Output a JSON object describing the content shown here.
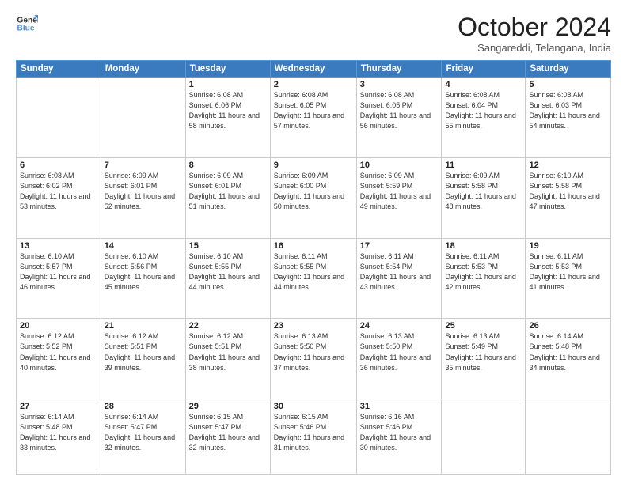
{
  "header": {
    "logo_line1": "General",
    "logo_line2": "Blue",
    "month": "October 2024",
    "location": "Sangareddi, Telangana, India"
  },
  "weekdays": [
    "Sunday",
    "Monday",
    "Tuesday",
    "Wednesday",
    "Thursday",
    "Friday",
    "Saturday"
  ],
  "weeks": [
    [
      {
        "day": "",
        "sunrise": "",
        "sunset": "",
        "daylight": ""
      },
      {
        "day": "",
        "sunrise": "",
        "sunset": "",
        "daylight": ""
      },
      {
        "day": "1",
        "sunrise": "Sunrise: 6:08 AM",
        "sunset": "Sunset: 6:06 PM",
        "daylight": "Daylight: 11 hours and 58 minutes."
      },
      {
        "day": "2",
        "sunrise": "Sunrise: 6:08 AM",
        "sunset": "Sunset: 6:05 PM",
        "daylight": "Daylight: 11 hours and 57 minutes."
      },
      {
        "day": "3",
        "sunrise": "Sunrise: 6:08 AM",
        "sunset": "Sunset: 6:05 PM",
        "daylight": "Daylight: 11 hours and 56 minutes."
      },
      {
        "day": "4",
        "sunrise": "Sunrise: 6:08 AM",
        "sunset": "Sunset: 6:04 PM",
        "daylight": "Daylight: 11 hours and 55 minutes."
      },
      {
        "day": "5",
        "sunrise": "Sunrise: 6:08 AM",
        "sunset": "Sunset: 6:03 PM",
        "daylight": "Daylight: 11 hours and 54 minutes."
      }
    ],
    [
      {
        "day": "6",
        "sunrise": "Sunrise: 6:08 AM",
        "sunset": "Sunset: 6:02 PM",
        "daylight": "Daylight: 11 hours and 53 minutes."
      },
      {
        "day": "7",
        "sunrise": "Sunrise: 6:09 AM",
        "sunset": "Sunset: 6:01 PM",
        "daylight": "Daylight: 11 hours and 52 minutes."
      },
      {
        "day": "8",
        "sunrise": "Sunrise: 6:09 AM",
        "sunset": "Sunset: 6:01 PM",
        "daylight": "Daylight: 11 hours and 51 minutes."
      },
      {
        "day": "9",
        "sunrise": "Sunrise: 6:09 AM",
        "sunset": "Sunset: 6:00 PM",
        "daylight": "Daylight: 11 hours and 50 minutes."
      },
      {
        "day": "10",
        "sunrise": "Sunrise: 6:09 AM",
        "sunset": "Sunset: 5:59 PM",
        "daylight": "Daylight: 11 hours and 49 minutes."
      },
      {
        "day": "11",
        "sunrise": "Sunrise: 6:09 AM",
        "sunset": "Sunset: 5:58 PM",
        "daylight": "Daylight: 11 hours and 48 minutes."
      },
      {
        "day": "12",
        "sunrise": "Sunrise: 6:10 AM",
        "sunset": "Sunset: 5:58 PM",
        "daylight": "Daylight: 11 hours and 47 minutes."
      }
    ],
    [
      {
        "day": "13",
        "sunrise": "Sunrise: 6:10 AM",
        "sunset": "Sunset: 5:57 PM",
        "daylight": "Daylight: 11 hours and 46 minutes."
      },
      {
        "day": "14",
        "sunrise": "Sunrise: 6:10 AM",
        "sunset": "Sunset: 5:56 PM",
        "daylight": "Daylight: 11 hours and 45 minutes."
      },
      {
        "day": "15",
        "sunrise": "Sunrise: 6:10 AM",
        "sunset": "Sunset: 5:55 PM",
        "daylight": "Daylight: 11 hours and 44 minutes."
      },
      {
        "day": "16",
        "sunrise": "Sunrise: 6:11 AM",
        "sunset": "Sunset: 5:55 PM",
        "daylight": "Daylight: 11 hours and 44 minutes."
      },
      {
        "day": "17",
        "sunrise": "Sunrise: 6:11 AM",
        "sunset": "Sunset: 5:54 PM",
        "daylight": "Daylight: 11 hours and 43 minutes."
      },
      {
        "day": "18",
        "sunrise": "Sunrise: 6:11 AM",
        "sunset": "Sunset: 5:53 PM",
        "daylight": "Daylight: 11 hours and 42 minutes."
      },
      {
        "day": "19",
        "sunrise": "Sunrise: 6:11 AM",
        "sunset": "Sunset: 5:53 PM",
        "daylight": "Daylight: 11 hours and 41 minutes."
      }
    ],
    [
      {
        "day": "20",
        "sunrise": "Sunrise: 6:12 AM",
        "sunset": "Sunset: 5:52 PM",
        "daylight": "Daylight: 11 hours and 40 minutes."
      },
      {
        "day": "21",
        "sunrise": "Sunrise: 6:12 AM",
        "sunset": "Sunset: 5:51 PM",
        "daylight": "Daylight: 11 hours and 39 minutes."
      },
      {
        "day": "22",
        "sunrise": "Sunrise: 6:12 AM",
        "sunset": "Sunset: 5:51 PM",
        "daylight": "Daylight: 11 hours and 38 minutes."
      },
      {
        "day": "23",
        "sunrise": "Sunrise: 6:13 AM",
        "sunset": "Sunset: 5:50 PM",
        "daylight": "Daylight: 11 hours and 37 minutes."
      },
      {
        "day": "24",
        "sunrise": "Sunrise: 6:13 AM",
        "sunset": "Sunset: 5:50 PM",
        "daylight": "Daylight: 11 hours and 36 minutes."
      },
      {
        "day": "25",
        "sunrise": "Sunrise: 6:13 AM",
        "sunset": "Sunset: 5:49 PM",
        "daylight": "Daylight: 11 hours and 35 minutes."
      },
      {
        "day": "26",
        "sunrise": "Sunrise: 6:14 AM",
        "sunset": "Sunset: 5:48 PM",
        "daylight": "Daylight: 11 hours and 34 minutes."
      }
    ],
    [
      {
        "day": "27",
        "sunrise": "Sunrise: 6:14 AM",
        "sunset": "Sunset: 5:48 PM",
        "daylight": "Daylight: 11 hours and 33 minutes."
      },
      {
        "day": "28",
        "sunrise": "Sunrise: 6:14 AM",
        "sunset": "Sunset: 5:47 PM",
        "daylight": "Daylight: 11 hours and 32 minutes."
      },
      {
        "day": "29",
        "sunrise": "Sunrise: 6:15 AM",
        "sunset": "Sunset: 5:47 PM",
        "daylight": "Daylight: 11 hours and 32 minutes."
      },
      {
        "day": "30",
        "sunrise": "Sunrise: 6:15 AM",
        "sunset": "Sunset: 5:46 PM",
        "daylight": "Daylight: 11 hours and 31 minutes."
      },
      {
        "day": "31",
        "sunrise": "Sunrise: 6:16 AM",
        "sunset": "Sunset: 5:46 PM",
        "daylight": "Daylight: 11 hours and 30 minutes."
      },
      {
        "day": "",
        "sunrise": "",
        "sunset": "",
        "daylight": ""
      },
      {
        "day": "",
        "sunrise": "",
        "sunset": "",
        "daylight": ""
      }
    ]
  ]
}
